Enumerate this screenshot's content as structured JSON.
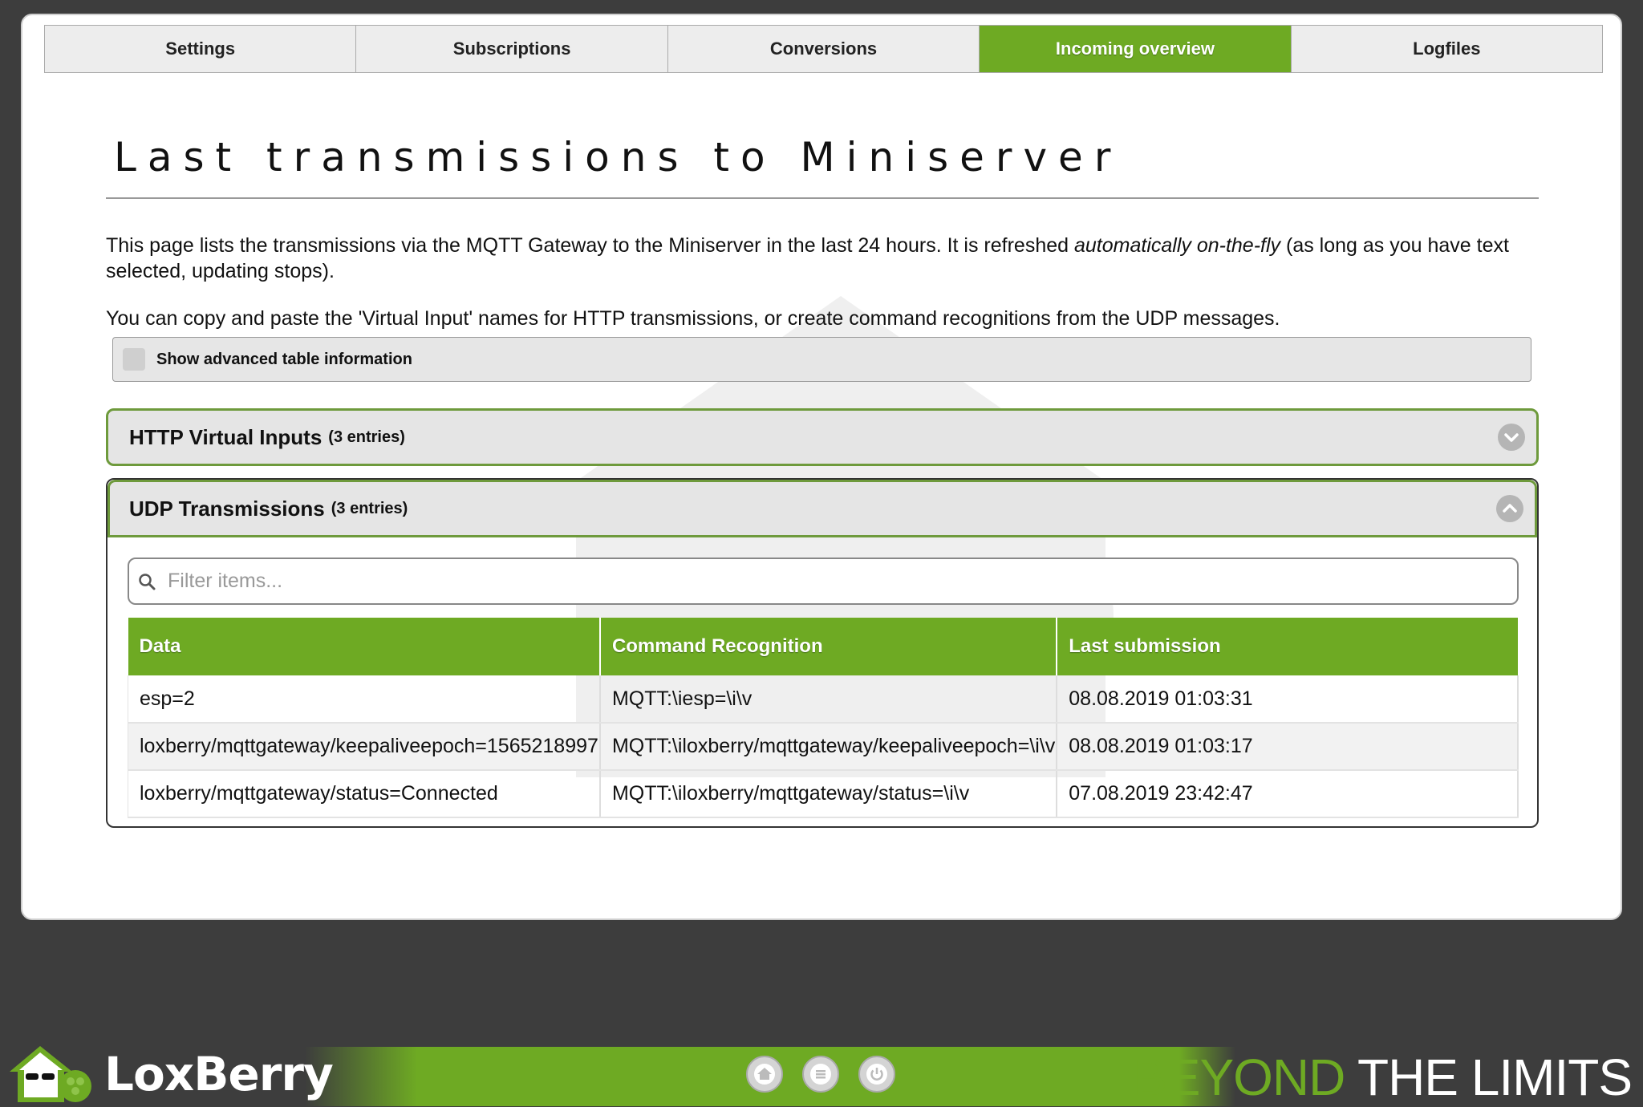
{
  "tabs": [
    {
      "label": "Settings",
      "active": false
    },
    {
      "label": "Subscriptions",
      "active": false
    },
    {
      "label": "Conversions",
      "active": false
    },
    {
      "label": "Incoming overview",
      "active": true
    },
    {
      "label": "Logfiles",
      "active": false
    }
  ],
  "page": {
    "title": "Last transmissions to Miniserver",
    "intro_part1": "This page lists the transmissions via the MQTT Gateway to the Miniserver in the last 24 hours. It is refreshed ",
    "intro_em": "automatically on-the-fly",
    "intro_part2": " (as long as you have text selected, updating stops).",
    "intro2": "You can copy and paste the 'Virtual Input' names for HTTP transmissions, or create command recognitions from the UDP messages."
  },
  "advanced": {
    "label": "Show advanced table information",
    "checked": false
  },
  "http_section": {
    "label": "HTTP Virtual Inputs",
    "count": "(3 entries)",
    "expanded": false
  },
  "udp_section": {
    "label": "UDP Transmissions",
    "count": "(3 entries)",
    "expanded": true,
    "filter_placeholder": "Filter items...",
    "columns": [
      "Data",
      "Command Recognition",
      "Last submission"
    ],
    "rows": [
      {
        "data": "esp=2",
        "command": "MQTT:\\iesp=\\i\\v",
        "last": "08.08.2019 01:03:31"
      },
      {
        "data": "loxberry/mqttgateway/keepaliveepoch=1565218997",
        "command": "MQTT:\\iloxberry/mqttgateway/keepaliveepoch=\\i\\v",
        "last": "08.08.2019 01:03:17"
      },
      {
        "data": "loxberry/mqttgateway/status=Connected",
        "command": "MQTT:\\iloxberry/mqttgateway/status=\\i\\v",
        "last": "07.08.2019 23:42:47"
      }
    ]
  },
  "footer": {
    "logo_text": "LoxBerry",
    "slogan_part1": "BEYOND",
    "slogan_part2": " THE LIMITS",
    "buttons": [
      "home-icon",
      "menu-icon",
      "power-icon"
    ]
  },
  "colors": {
    "accent_green": "#6eaa23",
    "background_dark": "#3d3d3d"
  }
}
